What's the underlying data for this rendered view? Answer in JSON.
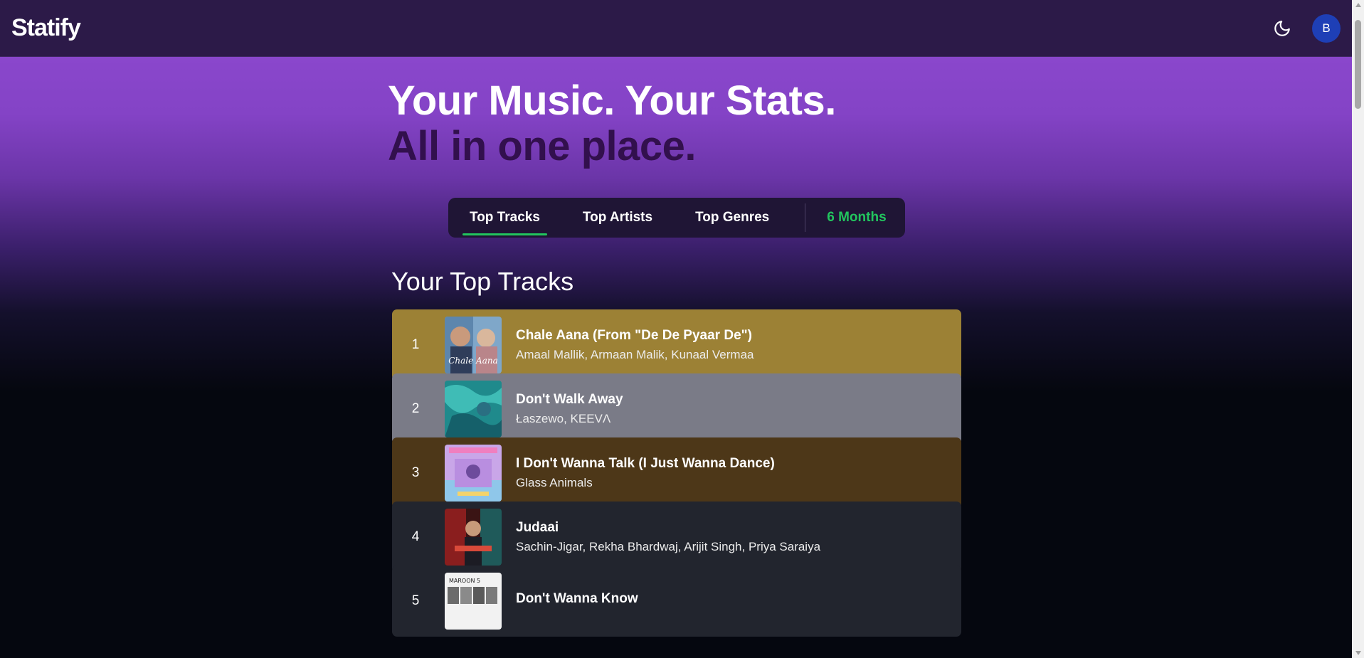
{
  "app": {
    "name": "Statify"
  },
  "header": {
    "theme_icon": "moon-icon",
    "avatar_initial": "B"
  },
  "hero": {
    "line1": "Your Music. Your Stats.",
    "line2": "All in one place."
  },
  "tabs": [
    {
      "label": "Top Tracks",
      "active": true
    },
    {
      "label": "Top Artists",
      "active": false
    },
    {
      "label": "Top Genres",
      "active": false
    }
  ],
  "time_range": "6 Months",
  "section_title": "Your Top Tracks",
  "tracks": [
    {
      "rank": "1",
      "title": "Chale Aana (From \"De De Pyaar De\")",
      "artists": "Amaal Mallik, Armaan Malik, Kunaal Vermaa",
      "bg": "#9c8135"
    },
    {
      "rank": "2",
      "title": "Don't Walk Away",
      "artists": "Łaszewo, KEEVΛ",
      "bg": "#7a7b87"
    },
    {
      "rank": "3",
      "title": "I Don't Wanna Talk (I Just Wanna Dance)",
      "artists": "Glass Animals",
      "bg": "#4d3718"
    },
    {
      "rank": "4",
      "title": "Judaai",
      "artists": "Sachin-Jigar, Rekha Bhardwaj, Arijit Singh, Priya Saraiya",
      "bg": "#22252e"
    },
    {
      "rank": "5",
      "title": "Don't Wanna Know",
      "artists": "",
      "bg": "#22252e"
    }
  ],
  "colors": {
    "accent": "#22c55e",
    "navbar": "#2c1a48",
    "avatar": "#1e3fb6"
  }
}
